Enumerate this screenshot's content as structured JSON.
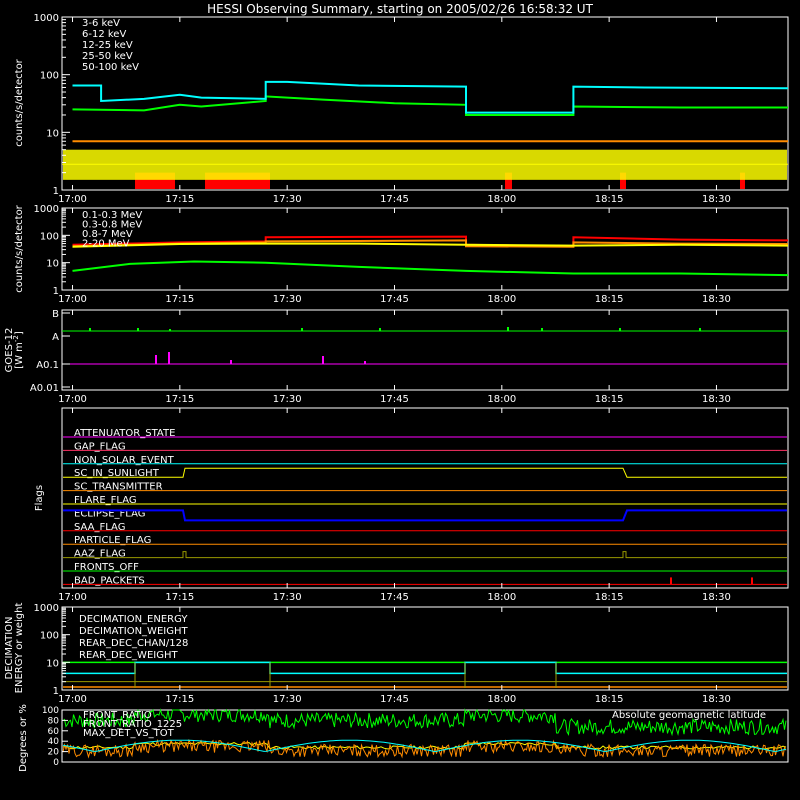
{
  "title": "HESSI Observing Summary, starting on 2005/02/26 16:58:32 UT",
  "time_ticks": [
    "17:00",
    "17:15",
    "17:30",
    "17:45",
    "18:00",
    "18:15",
    "18:30"
  ],
  "chart_data": [
    {
      "id": "lc-low",
      "type": "line",
      "ylabel": "counts/s/detector",
      "yscale": "log",
      "ylim": [
        1,
        1000
      ],
      "ytick_labels": [
        "1",
        "10",
        "100",
        "1000"
      ],
      "legend": [
        "3-6 keV",
        "6-12 keV",
        "12-25 keV",
        "25-50 keV",
        "50-100 keV"
      ],
      "series": [
        {
          "name": "3-6 keV",
          "color": "#ff0000",
          "render": "spikes",
          "x": [
            "17:13",
            "17:25",
            "18:00",
            "18:15",
            "18:30"
          ],
          "y": [
            2,
            2,
            2,
            2,
            2
          ]
        },
        {
          "name": "6-12 keV",
          "color": "#ff8c00",
          "x": [
            "17:00",
            "17:15",
            "17:27",
            "17:45",
            "17:55",
            "18:00",
            "18:10",
            "18:15",
            "18:30",
            "18:40"
          ],
          "y": [
            7,
            7,
            7,
            7,
            7,
            7,
            7,
            7,
            7,
            7
          ]
        },
        {
          "name": "12-25 keV",
          "color": "#ffff00",
          "render": "band",
          "x": [
            "17:00",
            "18:40"
          ],
          "y": [
            2.8,
            2.8
          ]
        },
        {
          "name": "25-50 keV",
          "color": "#00ff00",
          "x": [
            "17:00",
            "17:10",
            "17:15",
            "17:18",
            "17:27",
            "17:27",
            "17:35",
            "17:45",
            "17:55",
            "17:55",
            "18:10",
            "18:10",
            "18:25",
            "18:40"
          ],
          "y": [
            25,
            24,
            30,
            28,
            35,
            42,
            37,
            32,
            30,
            20,
            20,
            28,
            27,
            27
          ]
        },
        {
          "name": "50-100 keV",
          "color": "#00ffff",
          "x": [
            "17:00",
            "17:04",
            "17:04",
            "17:10",
            "17:15",
            "17:18",
            "17:27",
            "17:27",
            "17:30",
            "17:40",
            "17:55",
            "17:55",
            "18:10",
            "18:10",
            "18:20",
            "18:40"
          ],
          "y": [
            65,
            65,
            35,
            38,
            45,
            40,
            38,
            75,
            75,
            65,
            62,
            22,
            22,
            62,
            60,
            58
          ]
        }
      ]
    },
    {
      "id": "lc-high",
      "type": "line",
      "ylabel": "counts/s/detector",
      "yscale": "log",
      "ylim": [
        1,
        1000
      ],
      "ytick_labels": [
        "1",
        "10",
        "100",
        "1000"
      ],
      "legend": [
        "0.1-0.3 MeV",
        "0.3-0.8 MeV",
        "0.8-7 MeV",
        "2-20 MeV"
      ],
      "series": [
        {
          "name": "0.1-0.3 MeV",
          "color": "#ff0000",
          "x": [
            "17:00",
            "17:15",
            "17:27",
            "17:27",
            "17:40",
            "17:55",
            "17:55",
            "18:10",
            "18:10",
            "18:25",
            "18:40"
          ],
          "y": [
            45,
            55,
            60,
            85,
            88,
            90,
            45,
            40,
            85,
            70,
            65
          ]
        },
        {
          "name": "0.3-0.8 MeV",
          "color": "#ff8c00",
          "x": [
            "17:00",
            "17:15",
            "17:27",
            "17:27",
            "17:40",
            "17:55",
            "17:55",
            "18:10",
            "18:10",
            "18:25",
            "18:40"
          ],
          "y": [
            40,
            50,
            55,
            60,
            62,
            65,
            40,
            38,
            55,
            50,
            48
          ]
        },
        {
          "name": "0.8-7 MeV",
          "color": "#ffff00",
          "x": [
            "17:00",
            "17:15",
            "17:27",
            "17:40",
            "17:55",
            "18:10",
            "18:25",
            "18:40"
          ],
          "y": [
            38,
            48,
            50,
            50,
            45,
            42,
            45,
            42
          ]
        },
        {
          "name": "2-20 MeV",
          "color": "#00ff00",
          "x": [
            "17:00",
            "17:08",
            "17:17",
            "17:27",
            "17:40",
            "17:55",
            "18:10",
            "18:25",
            "18:40"
          ],
          "y": [
            5,
            9,
            11,
            10,
            7,
            5,
            4,
            4,
            3.5
          ]
        }
      ]
    }
  ],
  "goes": {
    "ylabel_1": "GOES-12",
    "ylabel_2": "[W m",
    "exp": "-2",
    "ylabel_3": "]",
    "tick_labels": [
      "B",
      "A",
      "A0.1",
      "A0.01"
    ],
    "colors": {
      "green": "#00ff00",
      "magenta": "#ff00ff"
    }
  },
  "flags": {
    "ylabel": "Flags",
    "items": [
      {
        "label": "ATTENUATOR_STATE",
        "color": "#ff00ff"
      },
      {
        "label": "GAP_FLAG",
        "color": "#ff3366"
      },
      {
        "label": "NON_SOLAR_EVENT",
        "color": "#00ffff"
      },
      {
        "label": "SC_IN_SUNLIGHT",
        "color": "#ffff00"
      },
      {
        "label": "SC_TRANSMITTER",
        "color": "#ff8c00"
      },
      {
        "label": "FLARE_FLAG",
        "color": "#ffff00"
      },
      {
        "label": "ECLIPSE_FLAG",
        "color": "#0000ff"
      },
      {
        "label": "SAA_FLAG",
        "color": "#ff0000"
      },
      {
        "label": "PARTICLE_FLAG",
        "color": "#ff8c00"
      },
      {
        "label": "AAZ_FLAG",
        "color": "#999900"
      },
      {
        "label": "FRONTS_OFF",
        "color": "#00ff00"
      },
      {
        "label": "BAD_PACKETS",
        "color": "#ff0000"
      }
    ]
  },
  "decimation": {
    "ylabel_1": "DECIMATION",
    "ylabel_2": "ENERGY or weight",
    "tick_labels": [
      "1",
      "10",
      "100",
      "1000"
    ],
    "legend": [
      {
        "label": "DECIMATION_ENERGY",
        "color": "#00ff00"
      },
      {
        "label": "DECIMATION_WEIGHT",
        "color": "#ff8c00"
      },
      {
        "label": "REAR_DEC_CHAN/128",
        "color": "#00ffff"
      },
      {
        "label": "REAR_DEC_WEIGHT",
        "color": "#999900"
      }
    ]
  },
  "ratio": {
    "ylabel": "Degrees or %",
    "tick_labels": [
      "0",
      "20",
      "40",
      "60",
      "80",
      "100"
    ],
    "legend": [
      {
        "label": "FRONT_RATIO",
        "color": "#ffff00"
      },
      {
        "label": "FRONT_RATIO_1225",
        "color": "#00ff00"
      },
      {
        "label": "MAX_DET_VS_TOT",
        "color": "#ff8c00"
      }
    ],
    "geomag_label": "Absolute geomagnetic latitude",
    "geomag_color": "#00ffff"
  }
}
